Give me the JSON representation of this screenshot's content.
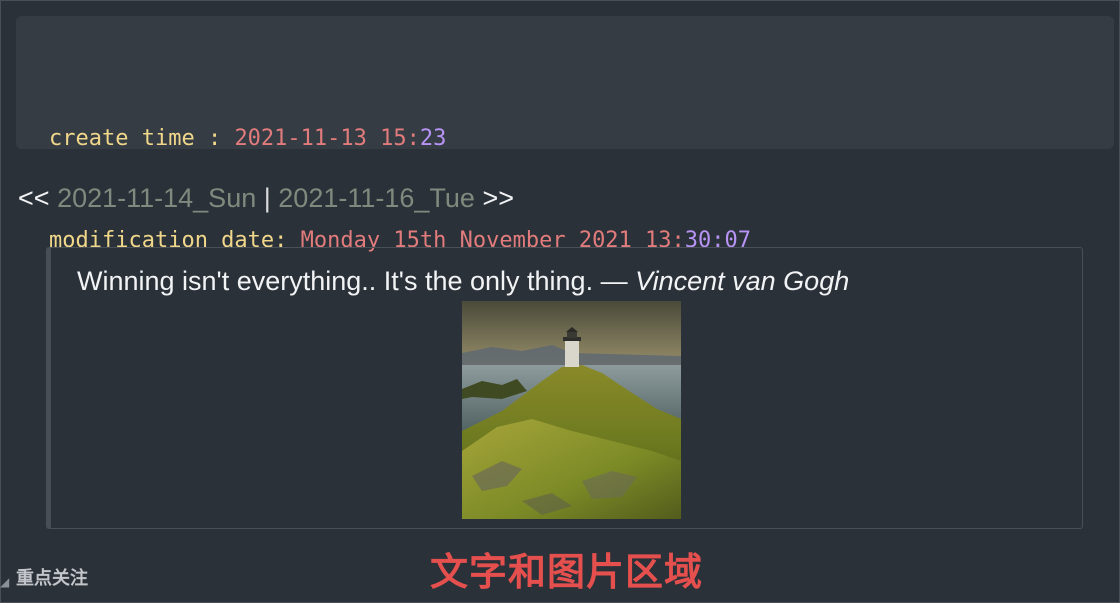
{
  "metadata_block": {
    "create_label": "create time : ",
    "create_value_main": "2021-11-13 15:",
    "create_value_minute": "23",
    "modified_label": "modification date: ",
    "modified_value_main": "Monday 15th November 2021 13:",
    "modified_value_time": "30:07"
  },
  "nav": {
    "prev_arrow": "<<",
    "prev_link": "2021-11-14_Sun",
    "separator": "|",
    "next_link": "2021-11-16_Tue",
    "next_arrow": ">>"
  },
  "quote": {
    "text": "Winning isn't everything.. It's the only thing. — ",
    "author": "Vincent van Gogh",
    "image_icon": "lighthouse-photo"
  },
  "footer": {
    "side_label": "重点关注",
    "caption": "文字和图片区域"
  },
  "colors": {
    "background": "#2b3138",
    "code_background": "#353c44",
    "key_yellow": "#f0d78a",
    "value_salmon": "#e27c7c",
    "value_purple": "#b794f4",
    "link_gray": "#7f8a7e",
    "caption_red": "#e5504e"
  }
}
